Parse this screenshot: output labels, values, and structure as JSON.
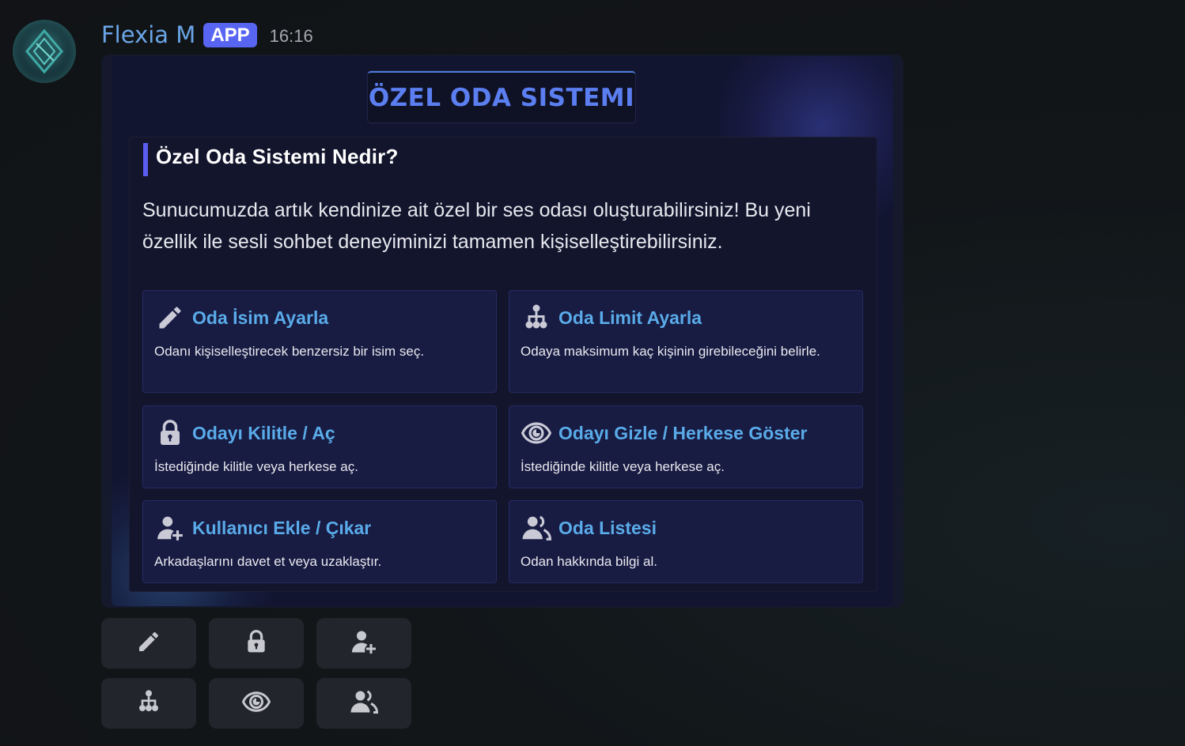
{
  "message": {
    "username": "Flexia M",
    "badge": "APP",
    "timestamp": "16:16"
  },
  "embed": {
    "title": "ÖZEL ODA SISTEMI",
    "section_title": "Özel Oda Sistemi Nedir?",
    "description": "Sunucumuzda artık kendinize ait özel bir ses odası oluşturabilirsiniz! Bu yeni özellik ile sesli sohbet deneyiminizi tamamen kişiselleştirebilirsiniz.",
    "features": [
      {
        "icon": "pencil-icon",
        "title": "Oda İsim Ayarla",
        "desc": "Odanı kişiselleştirecek benzersiz bir isim seç."
      },
      {
        "icon": "hierarchy-icon",
        "title": "Oda Limit Ayarla",
        "desc": "Odaya maksimum kaç kişinin girebileceğini belirle."
      },
      {
        "icon": "lock-icon",
        "title": "Odayı Kilitle / Aç",
        "desc": "İstediğinde kilitle veya herkese aç."
      },
      {
        "icon": "eye-icon",
        "title": "Odayı Gizle / Herkese Göster",
        "desc": "İstediğinde kilitle veya herkese aç."
      },
      {
        "icon": "user-add-icon",
        "title": "Kullanıcı Ekle / Çıkar",
        "desc": "Arkadaşlarını davet et veya uzaklaştır."
      },
      {
        "icon": "users-icon",
        "title": "Oda Listesi",
        "desc": "Odan hakkında bilgi al."
      }
    ]
  },
  "buttons": [
    {
      "icon": "pencil-icon"
    },
    {
      "icon": "lock-icon"
    },
    {
      "icon": "user-add-icon"
    },
    {
      "icon": "hierarchy-icon"
    },
    {
      "icon": "eye-icon"
    },
    {
      "icon": "users-icon"
    }
  ],
  "colors": {
    "accent": "#5865f2",
    "title_blue": "#5b7ef0",
    "feature_title": "#59abe9",
    "username": "#6aa5e8"
  }
}
